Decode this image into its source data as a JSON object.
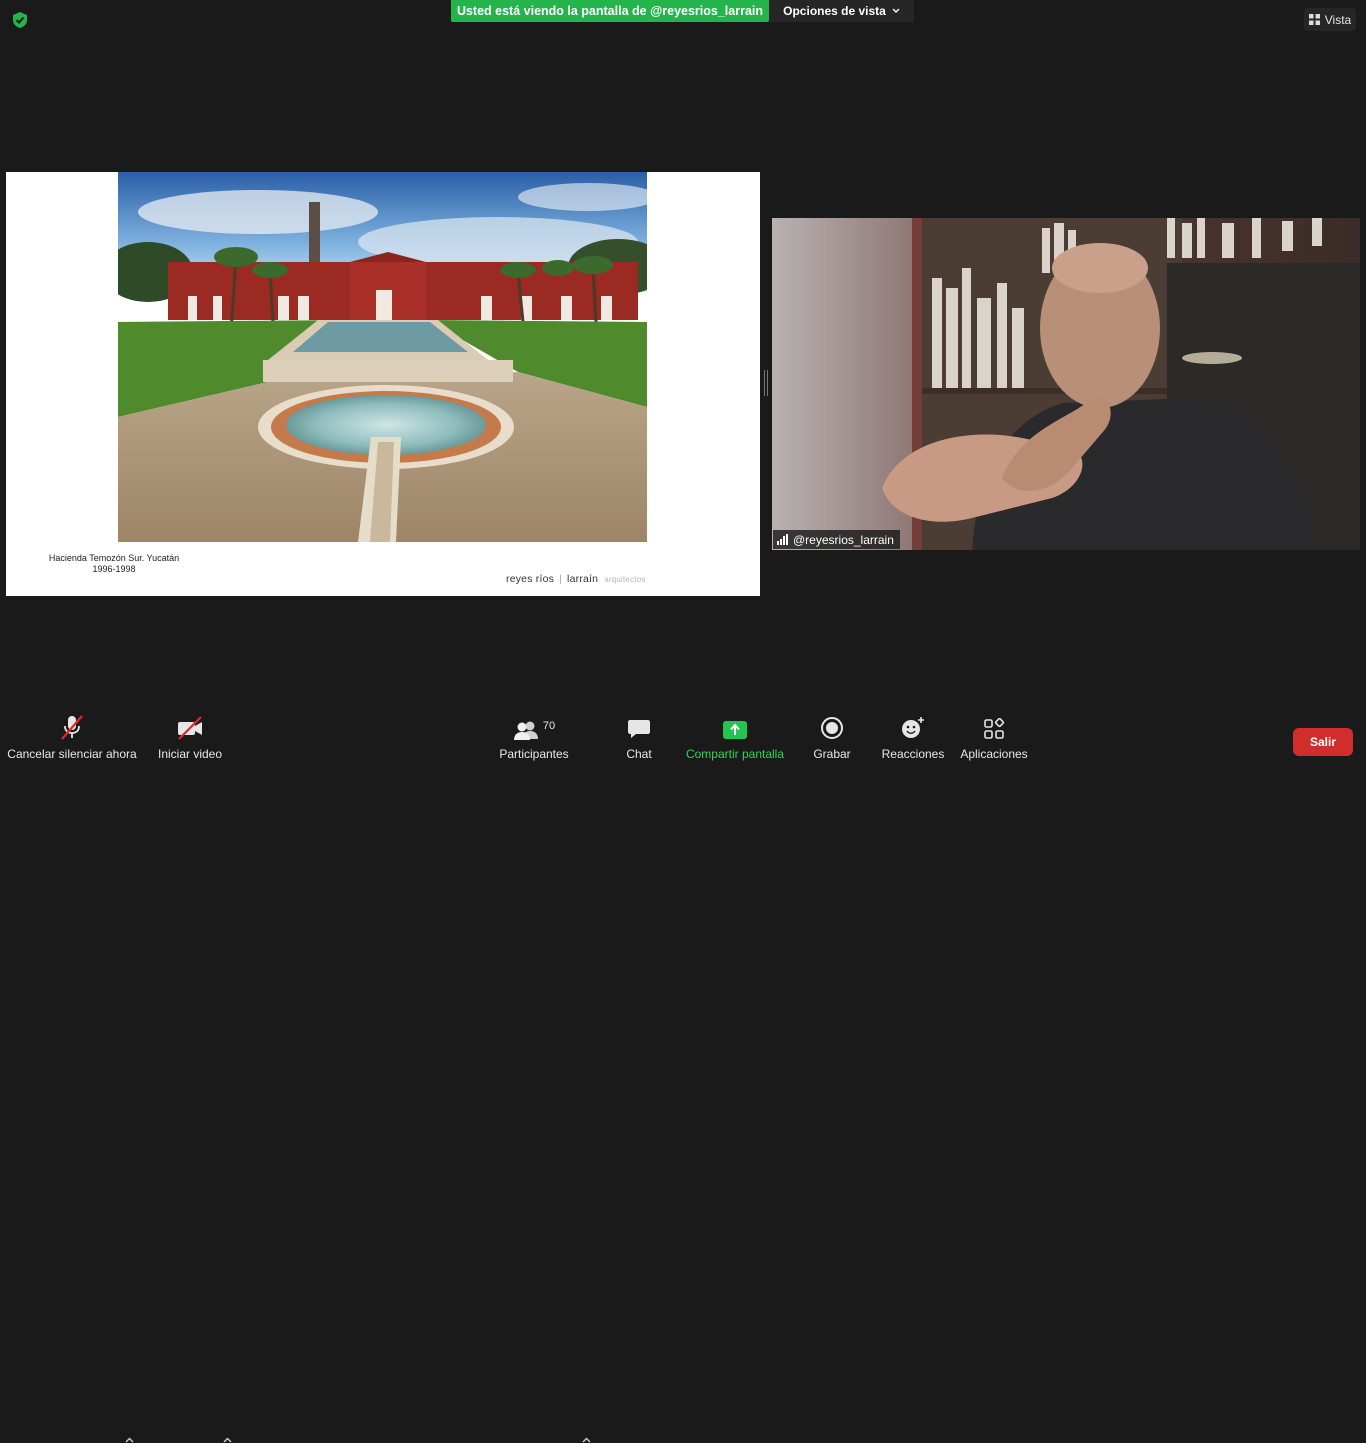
{
  "top_bar": {
    "share_banner": "Usted está viendo la pantalla de @reyesrios_larrain",
    "view_options": "Opciones de vista",
    "view_button": "Vista"
  },
  "slide": {
    "caption_line1": "Hacienda Temozón Sur. Yucatán",
    "caption_line2": "1996-1998",
    "brand_name1": "reyes ríos",
    "brand_sep": "|",
    "brand_name2": "larraín",
    "brand_suffix": "arquitectos"
  },
  "video": {
    "participant_name": "@reyesrios_larrain"
  },
  "toolbar": {
    "mute_label": "Cancelar silenciar ahora",
    "video_label": "Iniciar video",
    "participants_label": "Participantes",
    "participants_count": "70",
    "chat_label": "Chat",
    "share_label": "Compartir pantalla",
    "record_label": "Grabar",
    "reactions_label": "Reacciones",
    "apps_label": "Aplicaciones",
    "leave_label": "Salir"
  },
  "colors": {
    "background": "#1a1a1a",
    "share_green": "#23b54c",
    "leave_red": "#d12d2d"
  },
  "icons": [
    "shield-check-icon",
    "chevron-down-icon",
    "grid-view-icon",
    "signal-strength-icon",
    "microphone-muted-icon",
    "video-camera-off-icon",
    "participants-icon",
    "chat-bubble-icon",
    "share-screen-icon",
    "record-icon",
    "reactions-icon",
    "apps-icon"
  ]
}
